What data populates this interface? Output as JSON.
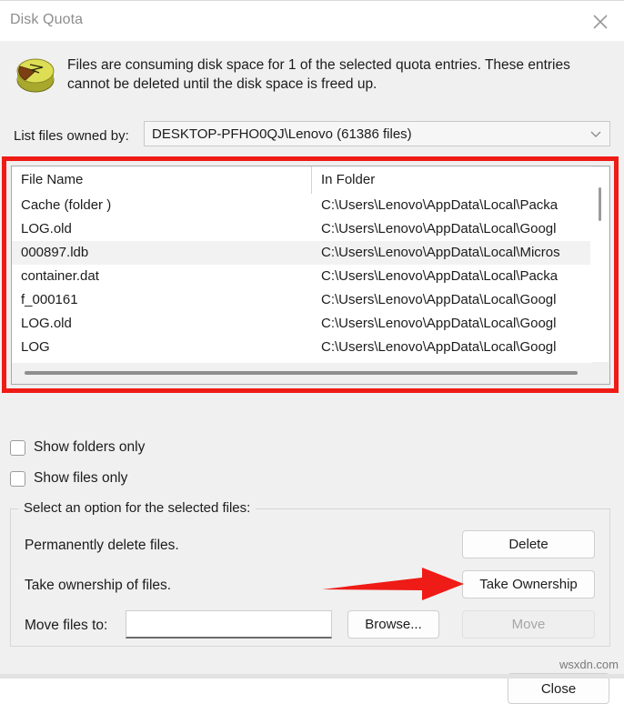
{
  "window": {
    "title": "Disk Quota",
    "close_icon": "close-x-icon"
  },
  "message": {
    "icon": "disk-quota-pie-icon",
    "text": "Files are consuming disk space for 1 of the selected quota entries.  These entries cannot be deleted until the disk space is freed up."
  },
  "owner": {
    "label": "List files owned by:",
    "value": "DESKTOP-PFHO0QJ\\Lenovo (61386 files)",
    "dropdown_icon": "chevron-down-icon"
  },
  "file_list": {
    "columns": [
      "File Name",
      "In Folder"
    ],
    "rows": [
      {
        "name": "Cache  (folder )",
        "folder": "C:\\Users\\Lenovo\\AppData\\Local\\Packa",
        "selected": false
      },
      {
        "name": "LOG.old",
        "folder": "C:\\Users\\Lenovo\\AppData\\Local\\Googl",
        "selected": false
      },
      {
        "name": "000897.ldb",
        "folder": "C:\\Users\\Lenovo\\AppData\\Local\\Micros",
        "selected": true
      },
      {
        "name": "container.dat",
        "folder": "C:\\Users\\Lenovo\\AppData\\Local\\Packa",
        "selected": false
      },
      {
        "name": "f_000161",
        "folder": "C:\\Users\\Lenovo\\AppData\\Local\\Googl",
        "selected": false
      },
      {
        "name": "LOG.old",
        "folder": "C:\\Users\\Lenovo\\AppData\\Local\\Googl",
        "selected": false
      },
      {
        "name": "LOG",
        "folder": "C:\\Users\\Lenovo\\AppData\\Local\\Googl",
        "selected": false
      }
    ]
  },
  "checkboxes": [
    {
      "label": "Show folders only",
      "checked": false
    },
    {
      "label": "Show files only",
      "checked": false
    }
  ],
  "options_group": {
    "legend": "Select an option for the selected files:",
    "delete_label": "Permanently delete files.",
    "delete_button": "Delete",
    "ownership_label": "Take ownership of files.",
    "ownership_button": "Take Ownership",
    "move_label": "Move files to:",
    "move_value": "",
    "move_placeholder": "",
    "browse_button": "Browse...",
    "move_button": "Move",
    "move_button_disabled": true
  },
  "footer": {
    "close_button": "Close",
    "watermark": "wsxdn.com"
  },
  "annotations": {
    "highlight_color": "#ee1b16",
    "arrow_color": "#ee1b16",
    "highlight_target": "file-list",
    "arrow_target": "take-ownership-button"
  }
}
